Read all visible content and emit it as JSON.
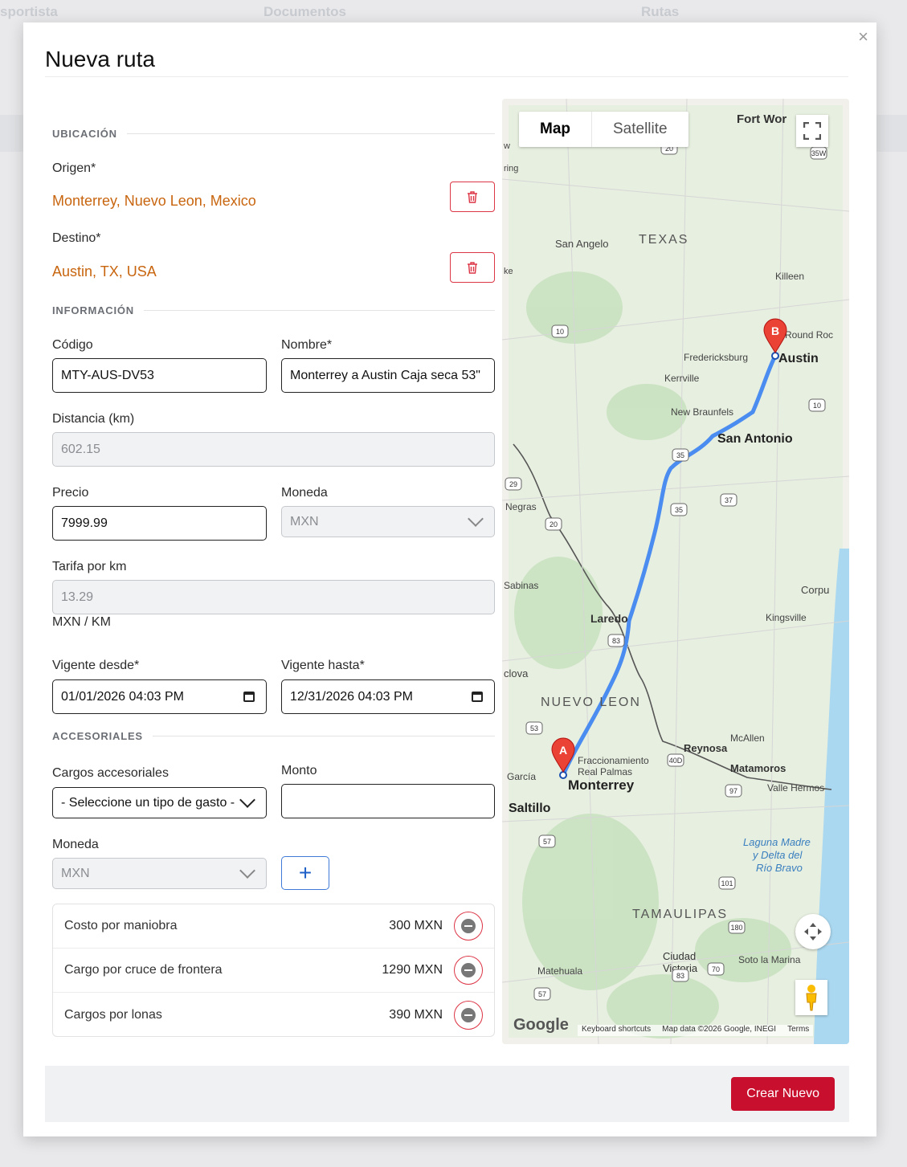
{
  "background": {
    "tabs": [
      "sportista",
      "Documentos",
      "Rutas"
    ]
  },
  "modal": {
    "title": "Nueva ruta",
    "close": "×",
    "ubicacion": {
      "heading": "UBICACIÓN",
      "origen_label": "Origen*",
      "origen_value": "Monterrey, Nuevo Leon, Mexico",
      "destino_label": "Destino*",
      "destino_value": "Austin, TX, USA"
    },
    "informacion": {
      "heading": "INFORMACIÓN",
      "codigo_label": "Código",
      "codigo_value": "MTY-AUS-DV53",
      "nombre_label": "Nombre*",
      "nombre_value": "Monterrey a Austin Caja seca 53\"",
      "distancia_label": "Distancia (km)",
      "distancia_value": "602.15",
      "precio_label": "Precio",
      "precio_value": "7999.99",
      "moneda_label": "Moneda",
      "moneda_value": "MXN",
      "tarifa_label": "Tarifa por km",
      "tarifa_value": "13.29",
      "tarifa_unit": "MXN / KM",
      "vigente_desde_label": "Vigente desde*",
      "vigente_desde_value": "01/01/2026 04:03 PM",
      "vigente_hasta_label": "Vigente hasta*",
      "vigente_hasta_value": "12/31/2026 04:03 PM"
    },
    "accesoriales": {
      "heading": "ACCESORIALES",
      "cargos_label": "Cargos accesoriales",
      "cargos_placeholder": "- Seleccione un tipo de gasto -",
      "monto_label": "Monto",
      "monto_value": "",
      "moneda_label": "Moneda",
      "moneda_value": "MXN",
      "add_label": "+",
      "items": [
        {
          "name": "Costo por maniobra",
          "amount": "300 MXN"
        },
        {
          "name": "Cargo por cruce de frontera",
          "amount": "1290 MXN"
        },
        {
          "name": "Cargos por lonas",
          "amount": "390 MXN"
        }
      ]
    },
    "map": {
      "type_map": "Map",
      "type_satellite": "Satellite",
      "marker_a": "A",
      "marker_b": "B",
      "labels": {
        "fort_worth": "Fort Wor",
        "san_angelo": "San Angelo",
        "texas": "TEXAS",
        "killeen": "Killeen",
        "round_rock": "Round Roc",
        "fredericksburg": "Fredericksburg",
        "austin": "Austin",
        "kerrville": "Kerrville",
        "new_braunfels": "New Braunfels",
        "san_antonio": "San Antonio",
        "negras": "Negras",
        "sabinas": "Sabinas",
        "corpus": "Corpu",
        "kingsville": "Kingsville",
        "laredo": "Laredo",
        "clova": "clova",
        "nuevo_leon": "NUEVO LEON",
        "mcallen": "McAllen",
        "reynosa": "Reynosa",
        "fraccionamiento": "Fraccionamiento",
        "real_palmas": "Real Palmas",
        "garcia": "García",
        "monterrey": "Monterrey",
        "matamoros": "Matamoros",
        "valle_hermoso": "Valle Hermos",
        "saltillo": "Saltillo",
        "laguna1": "Laguna Madre",
        "laguna2": "y Delta del",
        "laguna3": "Río Bravo",
        "tamaulipas": "TAMAULIPAS",
        "ciudad_victoria_1": "Ciudad",
        "ciudad_victoria_2": "Victoria",
        "soto_la_marina": "Soto la Marina",
        "matehuala": "Matehuala",
        "w": "w",
        "ring": "ring",
        "ke": "ke"
      },
      "shields": [
        "20",
        "35W",
        "35",
        "10",
        "10",
        "35",
        "37",
        "29",
        "20",
        "83",
        "53",
        "40D",
        "97",
        "57",
        "101",
        "180",
        "83",
        "70",
        "57"
      ],
      "google": "Google",
      "shortcuts": "Keyboard shortcuts",
      "map_data": "Map data ©2026 Google, INEGI",
      "terms": "Terms"
    },
    "footer": {
      "create_label": "Crear Nuevo"
    }
  },
  "colors": {
    "accent_red": "#c8102e",
    "address_orange": "#c8650f",
    "route_blue": "#4a8cf0"
  }
}
